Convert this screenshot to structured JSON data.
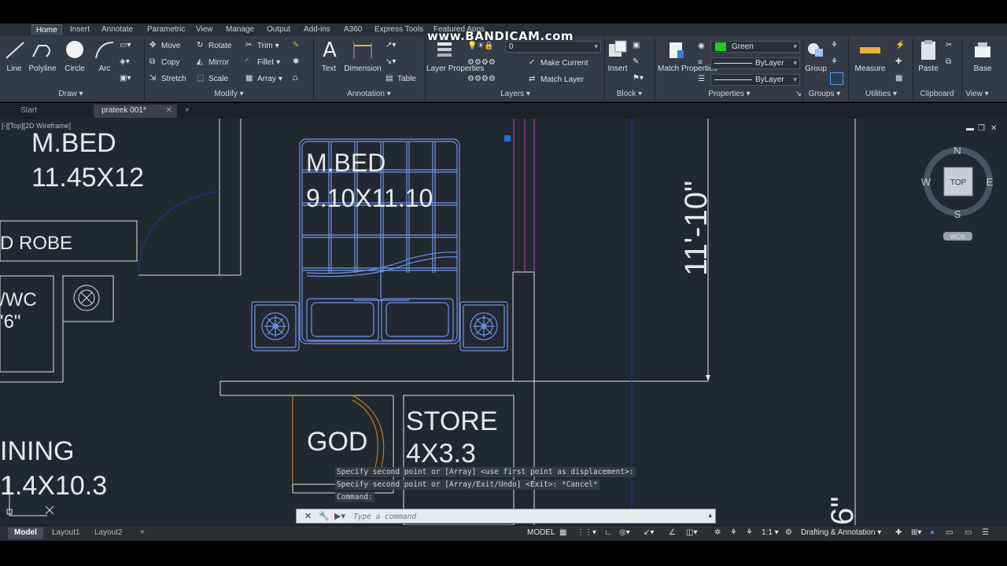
{
  "watermark": "www.BANDICAM.com",
  "ribbon": {
    "tabs": [
      "Home",
      "Insert",
      "Annotate",
      "Parametric",
      "View",
      "Manage",
      "Output",
      "Add-ins",
      "A360",
      "Express Tools",
      "Featured Apps"
    ],
    "active_tab": "Home",
    "draw": {
      "title": "Draw",
      "line": "Line",
      "polyline": "Polyline",
      "circle": "Circle",
      "arc": "Arc"
    },
    "modify": {
      "title": "Modify",
      "move": "Move",
      "rotate": "Rotate",
      "trim": "Trim",
      "copy": "Copy",
      "mirror": "Mirror",
      "fillet": "Fillet",
      "stretch": "Stretch",
      "scale": "Scale",
      "array": "Array"
    },
    "annotation": {
      "title": "Annotation",
      "text": "Text",
      "dimension": "Dimension",
      "table": "Table"
    },
    "layers": {
      "title": "Layers",
      "layer_properties": "Layer Properties",
      "current_layer": "0",
      "make_current": "Make Current",
      "match_layer": "Match Layer"
    },
    "block": {
      "title": "Block",
      "insert": "Insert"
    },
    "properties": {
      "title": "Properties",
      "match_properties": "Match Properties",
      "color": "Green",
      "linetype": "ByLayer",
      "lineweight": "ByLayer"
    },
    "groups": {
      "title": "Groups",
      "group": "Group"
    },
    "utilities": {
      "title": "Utilities",
      "measure": "Measure"
    },
    "clipboard": {
      "title": "Clipboard",
      "paste": "Paste"
    },
    "view": {
      "title": "View",
      "base": "Base"
    }
  },
  "doc_tabs": [
    {
      "label": "Start"
    },
    {
      "label": "prateek 001*"
    }
  ],
  "viewport": {
    "label": "[-][Top][2D Wireframe]"
  },
  "viewcube": {
    "n": "N",
    "s": "S",
    "e": "E",
    "w": "W",
    "face": "TOP",
    "wcs": "WCS"
  },
  "drawing": {
    "mbed1_name": "M.BED",
    "mbed1_size": "11.45X12",
    "robe": "D  ROBE",
    "wc1": "/WC",
    "wc2": "'6\"",
    "mbed2_name": "M.BED",
    "mbed2_size": "9.10X11.10",
    "dimension": "11'-10\"",
    "god": "GOD",
    "store_name": "STORE",
    "store_size": "4X3.3",
    "dining_name": "INING",
    "dining_size": "1.4X10.3",
    "dim_bottom": "6\""
  },
  "command": {
    "history": [
      "Specify second point or [Array] <use first point as displacement>:",
      "Specify second point or [Array/Exit/Undo] <Exit>: *Cancel*",
      "Command:"
    ],
    "placeholder": "Type a command"
  },
  "statusbar": {
    "tabs": [
      "Model",
      "Layout1",
      "Layout2"
    ],
    "model": "MODEL",
    "scale": "1:1",
    "workspace": "Drafting & Annotation"
  },
  "colors": {
    "bg": "#212830",
    "lines": "#e6e6e6",
    "bed": "#6f95e8",
    "magenta": "#c03cc0",
    "blue": "#2a2ad0",
    "door": "#d98a20",
    "green": "#22cc22"
  }
}
